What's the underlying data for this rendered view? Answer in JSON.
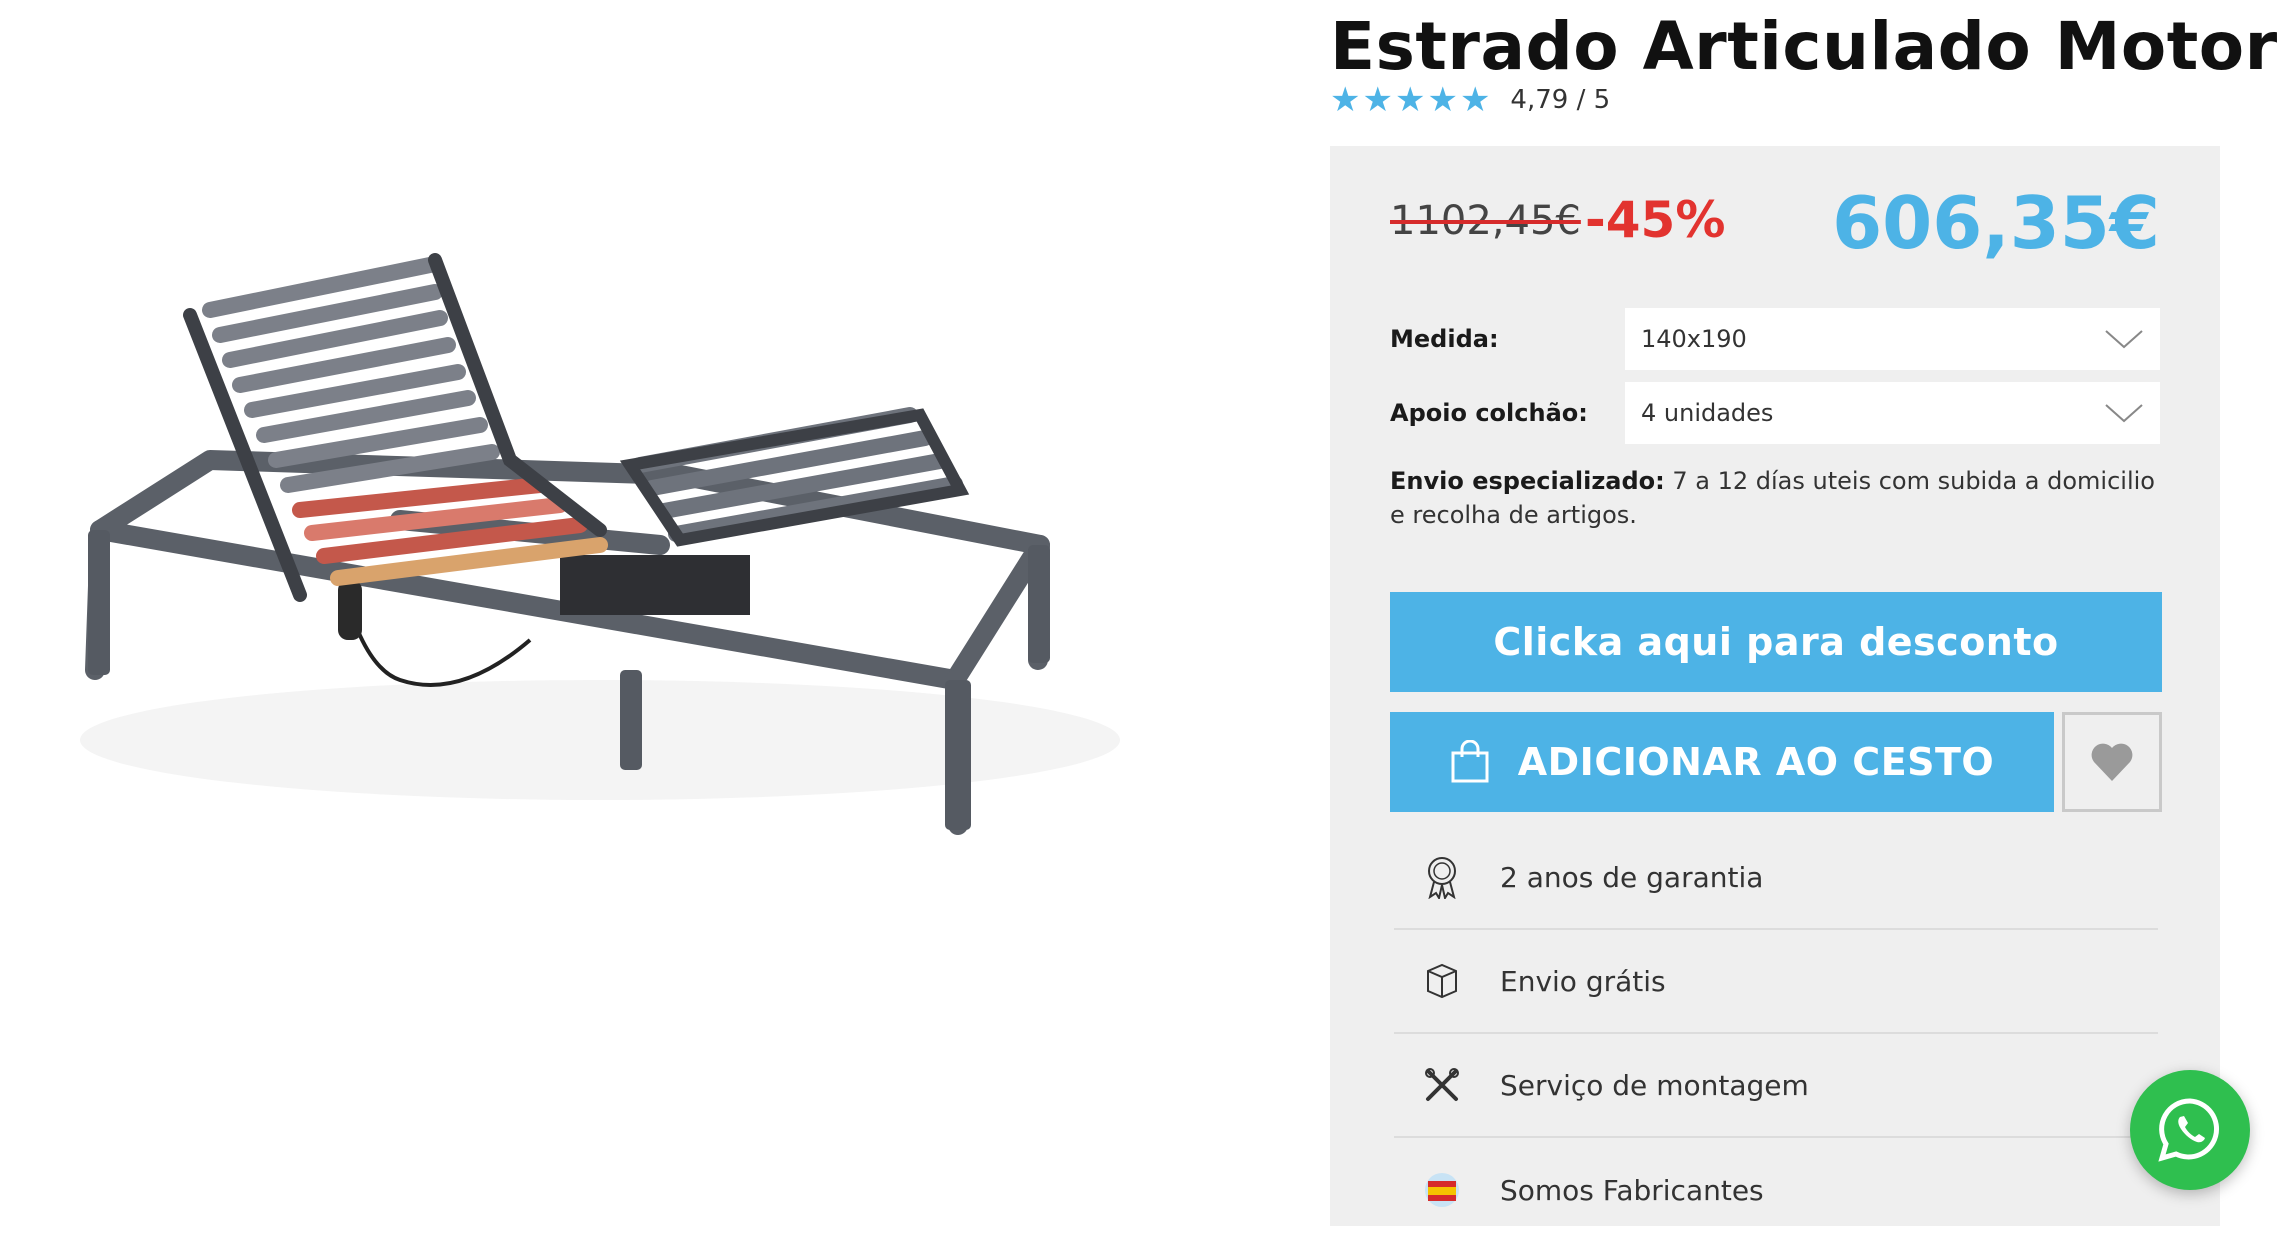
{
  "product": {
    "title": "Estrado Articulado Motor",
    "rating_text": "4,79 / 5",
    "rating_value": 4.79,
    "rating_max": 5
  },
  "pricing": {
    "old_price": "1102,45€",
    "discount": "-45%",
    "price": "606,35€"
  },
  "options": [
    {
      "label": "Medida:",
      "value": "140x190"
    },
    {
      "label": "Apoio colchão:",
      "value": "4 unidades"
    }
  ],
  "shipping": {
    "label": "Envio especializado:",
    "text": " 7 a 12 días uteis com subida a domicilio e recolha de artigos."
  },
  "buttons": {
    "discount_label": "Clicka aqui para desconto",
    "cart_label": "ADICIONAR AO CESTO"
  },
  "features": [
    {
      "icon": "award-icon",
      "label": "2 anos de garantia"
    },
    {
      "icon": "box-icon",
      "label": "Envio grátis"
    },
    {
      "icon": "tools-icon",
      "label": "Serviço de montagem"
    },
    {
      "icon": "spain-flag-icon",
      "label": "Somos Fabricantes"
    }
  ],
  "colors": {
    "accent": "#4db3e6",
    "discount_red": "#e2332f",
    "whatsapp_green": "#2fbf4f",
    "panel_bg": "#efefef"
  }
}
